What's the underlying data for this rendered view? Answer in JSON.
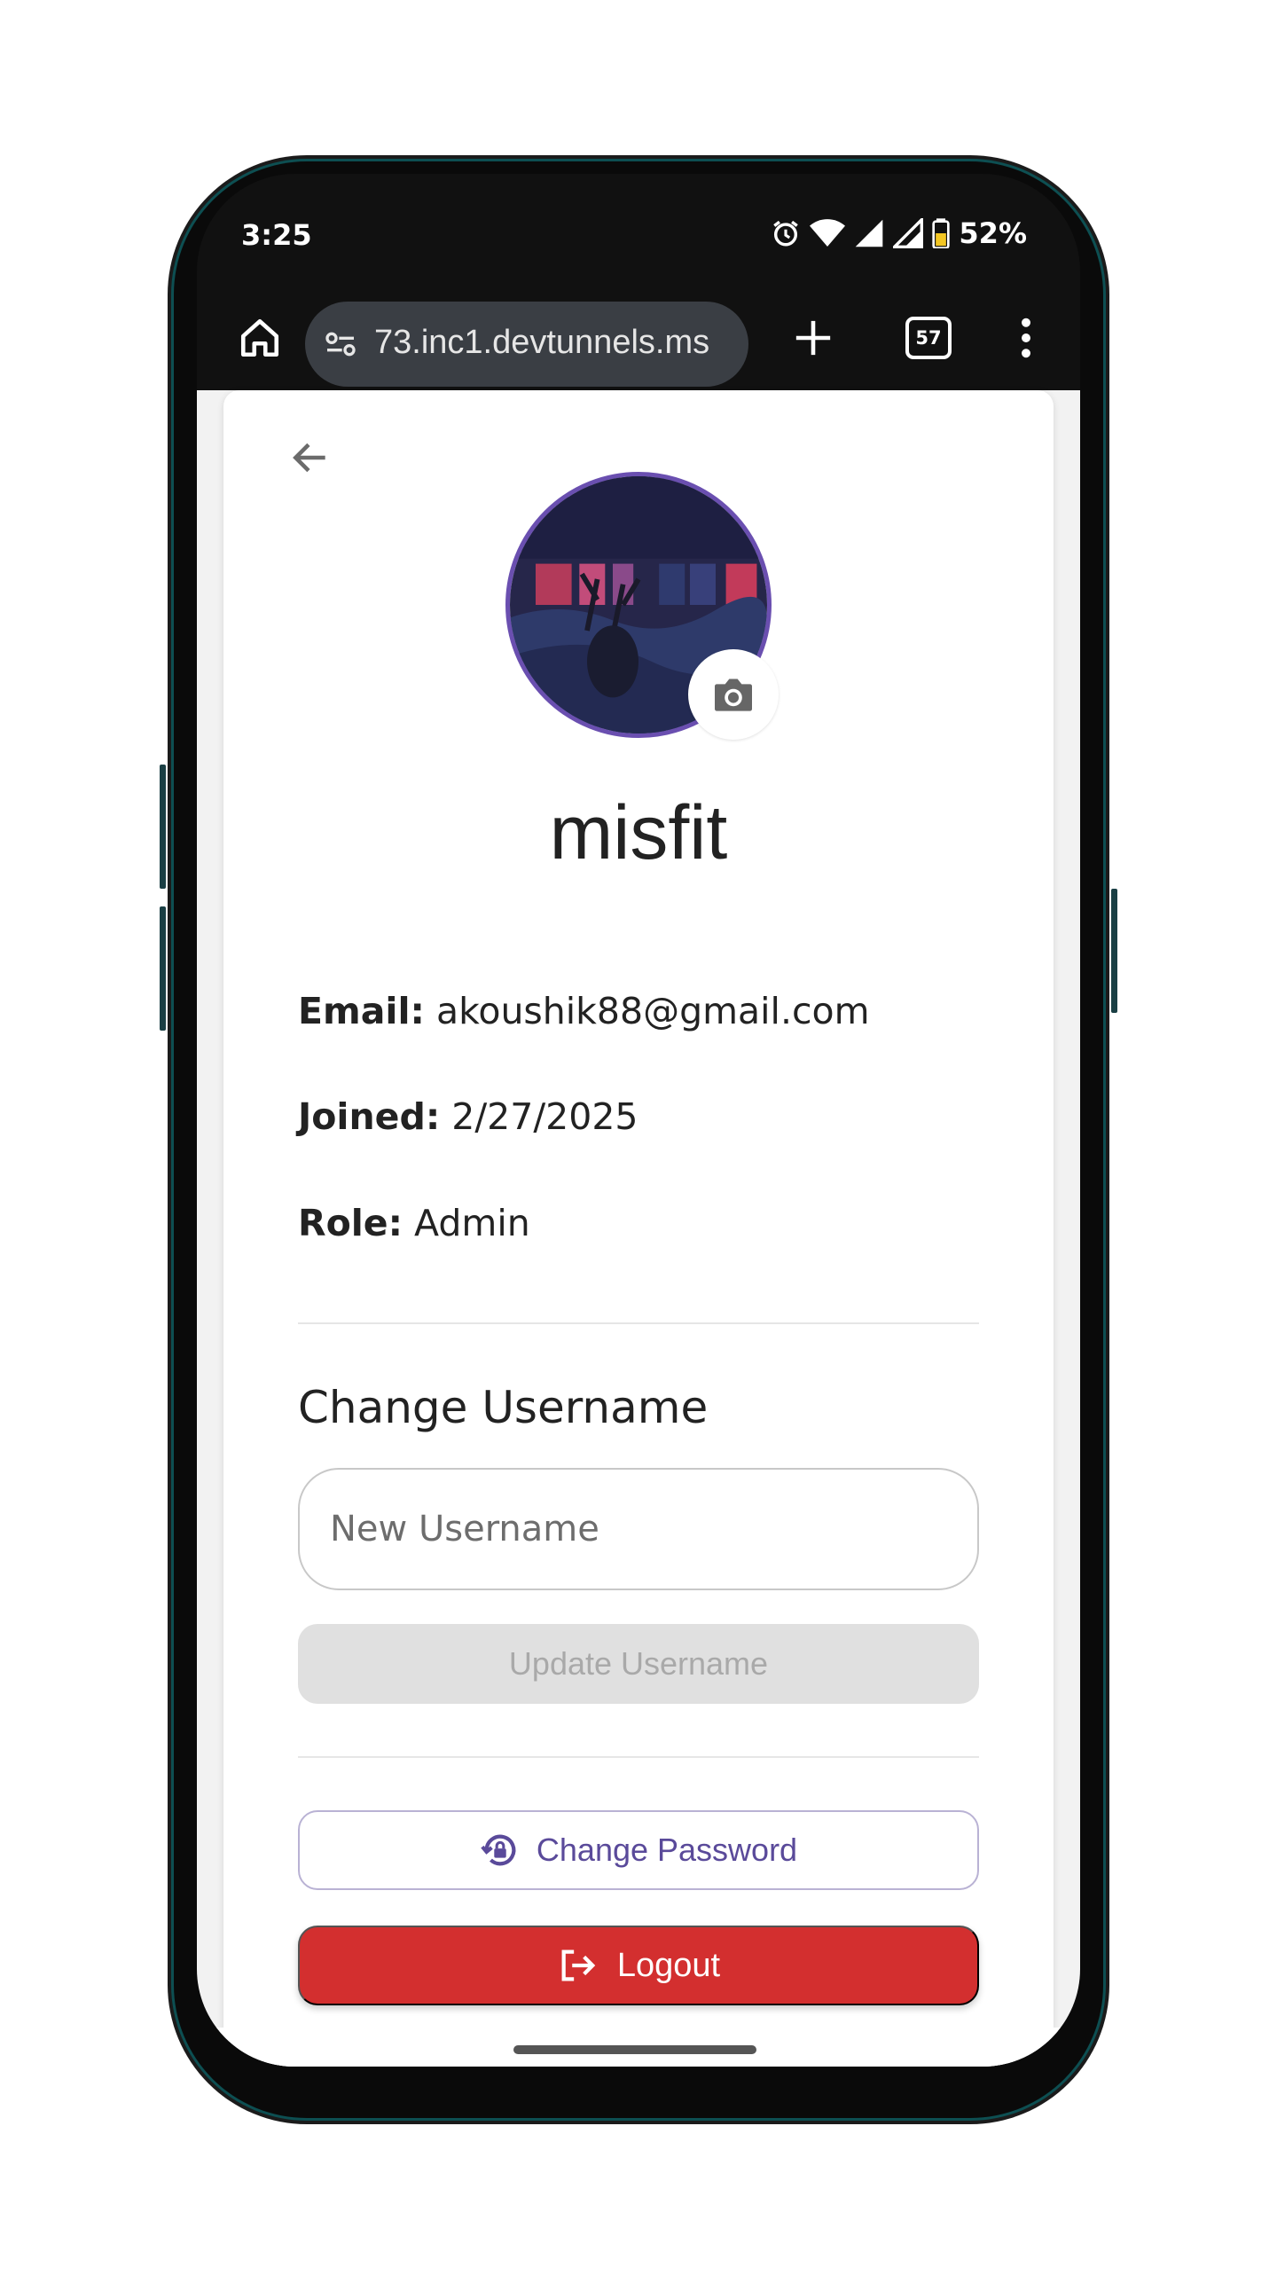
{
  "status_bar": {
    "time": "3:25",
    "battery": "52%"
  },
  "browser": {
    "url": "73.inc1.devtunnels.ms",
    "tab_count": "57"
  },
  "profile": {
    "username": "misfit",
    "email_label": "Email:",
    "email": "akoushik88@gmail.com",
    "joined_label": "Joined:",
    "joined": "2/27/2025",
    "role_label": "Role:",
    "role": "Admin"
  },
  "change_username": {
    "title": "Change Username",
    "placeholder": "New Username",
    "button": "Update Username"
  },
  "actions": {
    "change_password": "Change Password",
    "logout": "Logout"
  },
  "colors": {
    "accent": "#6a4fb0",
    "logout": "#d32f2f",
    "disabled": "#e0e0e0"
  }
}
